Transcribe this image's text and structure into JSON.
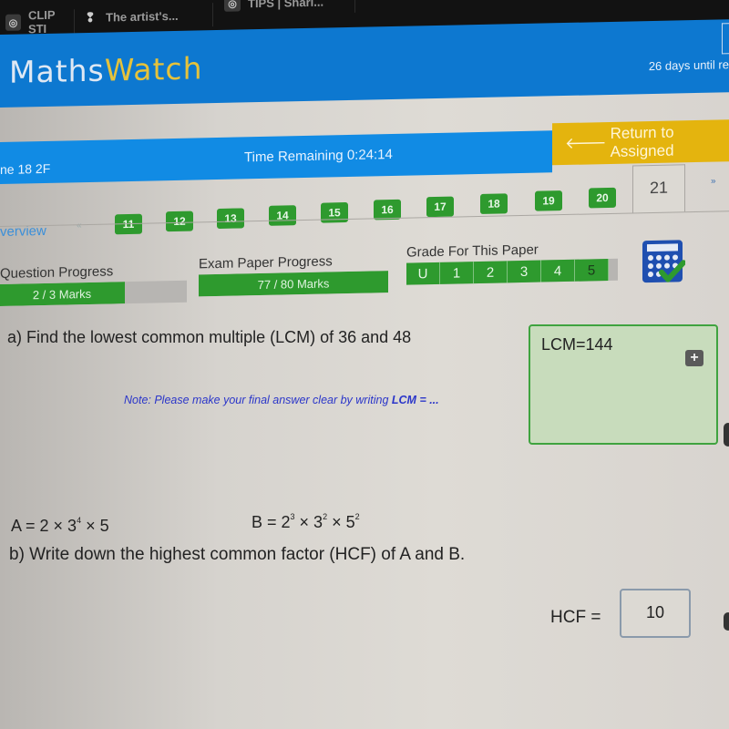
{
  "browser": {
    "tabs": [
      {
        "label": "CLIP STI",
        "icon": "clip-studio-icon"
      },
      {
        "label": "The artist's...",
        "icon": "artist-icon"
      },
      {
        "label": "TIPS | Shari...",
        "icon": "clip-studio-icon"
      }
    ]
  },
  "header": {
    "logo_part1": "Maths",
    "logo_part2": "Watch",
    "days_until": "26 days until re"
  },
  "titlebar": {
    "paper_name": "ne 18 2F",
    "time_remaining": "Time Remaining 0:24:14",
    "return_button": "Return to Assigned",
    "return_icon": "arrow-left-icon"
  },
  "question_nav": {
    "overview_label": "verview",
    "prev_symbol": "«",
    "next_symbol": "»",
    "questions": [
      "11",
      "12",
      "13",
      "14",
      "15",
      "16",
      "17",
      "18",
      "19",
      "20"
    ],
    "current_question": "21",
    "colors": {
      "completed": "#2e9a2e"
    }
  },
  "progress": {
    "question_progress_label": "Question Progress",
    "question_progress_text": "2 / 3 Marks",
    "question_progress_fraction": 0.667,
    "exam_progress_label": "Exam Paper Progress",
    "exam_progress_text": "77 / 80 Marks",
    "exam_progress_fraction": 0.9625,
    "grade_label": "Grade For This Paper",
    "grades": [
      "U",
      "1",
      "2",
      "3",
      "4",
      "5"
    ],
    "current_grade": "5",
    "calculator_icon": "calculator-allowed-icon"
  },
  "part_a": {
    "question": "a) Find the lowest common multiple (LCM) of 36 and 48",
    "note_prefix": "Note: Please make your final answer clear by writing ",
    "note_bold": "LCM = ...",
    "answer": "LCM=144",
    "add_button": "+"
  },
  "part_b": {
    "eq_a_prefix": "A = 2 × 3",
    "eq_a_exp": "4",
    "eq_a_suffix": " × 5",
    "eq_b_prefix": "B = 2",
    "eq_b_exp1": "3",
    "eq_b_mid": " × 3",
    "eq_b_exp2": "2",
    "eq_b_mid2": " × 5",
    "eq_b_exp3": "2",
    "question": "b) Write down the highest common factor (HCF) of A and B.",
    "hcf_label": "HCF =",
    "hcf_answer": "10"
  }
}
